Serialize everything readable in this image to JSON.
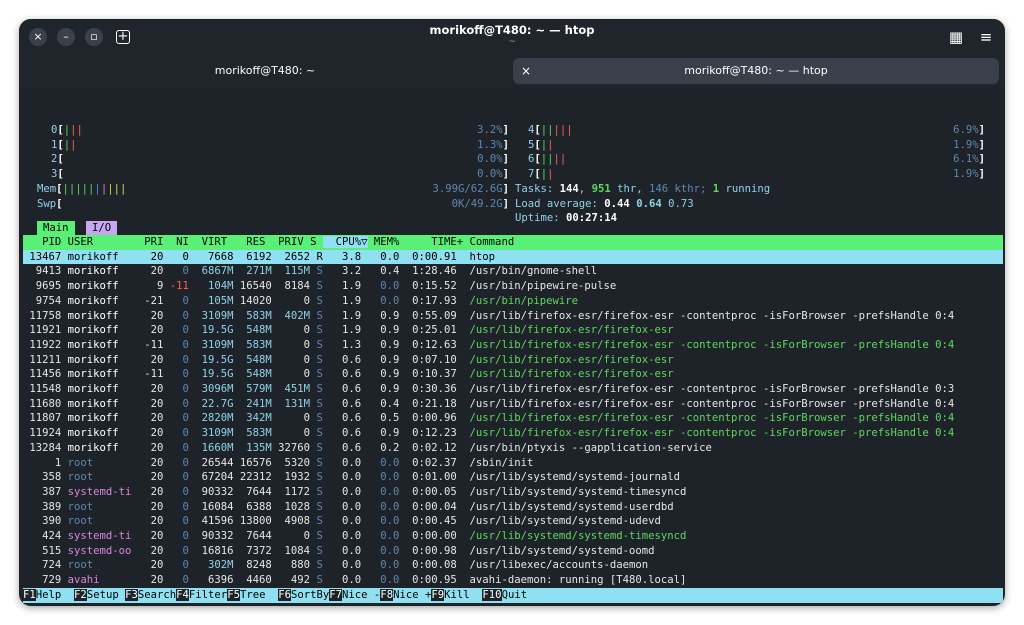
{
  "window": {
    "title": "morikoff@T480: ~ — htop",
    "subtitle": "~",
    "close_icon": "×",
    "minimize_icon": "–",
    "maximize_icon": "▫",
    "new_tab_icon": "+",
    "grid_icon": "▦",
    "menu_icon": "≡"
  },
  "tabs": [
    {
      "label": "morikoff@T480: ~",
      "active": false
    },
    {
      "label": "morikoff@T480: ~ — htop",
      "active": true
    }
  ],
  "meters": {
    "cpus": [
      {
        "id": "0",
        "bars": "|||",
        "value": "3.2%"
      },
      {
        "id": "1",
        "bars": "||",
        "value": "1.3%"
      },
      {
        "id": "2",
        "bars": "",
        "value": "0.0%"
      },
      {
        "id": "3",
        "bars": "",
        "value": "0.0%"
      },
      {
        "id": "4",
        "bars": "|||||",
        "value": "6.9%"
      },
      {
        "id": "5",
        "bars": "||",
        "value": "1.9%"
      },
      {
        "id": "6",
        "bars": "||||",
        "value": "6.1%"
      },
      {
        "id": "7",
        "bars": "||",
        "value": "1.9%"
      }
    ],
    "mem": {
      "label": "Mem",
      "bars": "||||||||||",
      "value": "3.99G/62.6G"
    },
    "swp": {
      "label": "Swp",
      "bars": "",
      "value": "0K/49.2G"
    },
    "tasks": {
      "label": "Tasks:",
      "count": "144",
      "thr": "951",
      "thr_label": "thr,",
      "kthr": "146 kthr;",
      "running": "1",
      "running_label": "running"
    },
    "load": {
      "label": "Load average:",
      "v1": "0.44",
      "v2": "0.64",
      "v3": "0.73"
    },
    "uptime": {
      "label": "Uptime:",
      "value": "00:27:14"
    }
  },
  "screen_tabs": [
    "Main",
    "I/O"
  ],
  "columns": [
    "PID",
    "USER",
    "PRI",
    "NI",
    "VIRT",
    "RES",
    "PRIV",
    "S",
    "CPU%▽",
    "MEM%",
    "TIME+",
    "Command"
  ],
  "processes": [
    {
      "pid": "13467",
      "user": "morikoff",
      "pri": "20",
      "ni": "0",
      "virt": "7668",
      "res": "6192",
      "priv": "2652",
      "s": "R",
      "cpu": "3.8",
      "mem": "0.0",
      "time": "0:00.91",
      "cmd": "htop",
      "sel": true
    },
    {
      "pid": "9413",
      "user": "morikoff",
      "pri": "20",
      "ni": "0",
      "virt": "6867M",
      "res": "271M",
      "priv": "115M",
      "s": "S",
      "cpu": "3.2",
      "mem": "0.4",
      "time": "1:28.46",
      "cmd": "/usr/bin/gnome-shell"
    },
    {
      "pid": "9695",
      "user": "morikoff",
      "pri": "9",
      "ni": "-11",
      "virt": "104M",
      "res": "16540",
      "priv": "8184",
      "s": "S",
      "cpu": "1.9",
      "mem": "0.0",
      "time": "0:15.52",
      "cmd": "/usr/bin/pipewire-pulse"
    },
    {
      "pid": "9754",
      "user": "morikoff",
      "pri": "-21",
      "ni": "0",
      "virt": "105M",
      "res": "14020",
      "priv": "0",
      "s": "S",
      "cpu": "1.9",
      "mem": "0.0",
      "time": "0:17.93",
      "cmd": "/usr/bin/pipewire",
      "thread": true
    },
    {
      "pid": "11758",
      "user": "morikoff",
      "pri": "20",
      "ni": "0",
      "virt": "3109M",
      "res": "583M",
      "priv": "402M",
      "s": "S",
      "cpu": "1.9",
      "mem": "0.9",
      "time": "0:55.09",
      "cmd": "/usr/lib/firefox-esr/firefox-esr -contentproc -isForBrowser -prefsHandle 0:4"
    },
    {
      "pid": "11921",
      "user": "morikoff",
      "pri": "20",
      "ni": "0",
      "virt": "19.5G",
      "res": "548M",
      "priv": "0",
      "s": "S",
      "cpu": "1.9",
      "mem": "0.9",
      "time": "0:25.01",
      "cmd": "/usr/lib/firefox-esr/firefox-esr",
      "thread": true
    },
    {
      "pid": "11922",
      "user": "morikoff",
      "pri": "-11",
      "ni": "0",
      "virt": "3109M",
      "res": "583M",
      "priv": "0",
      "s": "S",
      "cpu": "1.3",
      "mem": "0.9",
      "time": "0:12.63",
      "cmd": "/usr/lib/firefox-esr/firefox-esr -contentproc -isForBrowser -prefsHandle 0:4",
      "thread": true
    },
    {
      "pid": "11211",
      "user": "morikoff",
      "pri": "20",
      "ni": "0",
      "virt": "19.5G",
      "res": "548M",
      "priv": "0",
      "s": "S",
      "cpu": "0.6",
      "mem": "0.9",
      "time": "0:07.10",
      "cmd": "/usr/lib/firefox-esr/firefox-esr",
      "thread": true
    },
    {
      "pid": "11456",
      "user": "morikoff",
      "pri": "-11",
      "ni": "0",
      "virt": "19.5G",
      "res": "548M",
      "priv": "0",
      "s": "S",
      "cpu": "0.6",
      "mem": "0.9",
      "time": "0:10.37",
      "cmd": "/usr/lib/firefox-esr/firefox-esr",
      "thread": true
    },
    {
      "pid": "11548",
      "user": "morikoff",
      "pri": "20",
      "ni": "0",
      "virt": "3096M",
      "res": "579M",
      "priv": "451M",
      "s": "S",
      "cpu": "0.6",
      "mem": "0.9",
      "time": "0:30.36",
      "cmd": "/usr/lib/firefox-esr/firefox-esr -contentproc -isForBrowser -prefsHandle 0:3"
    },
    {
      "pid": "11680",
      "user": "morikoff",
      "pri": "20",
      "ni": "0",
      "virt": "22.7G",
      "res": "241M",
      "priv": "131M",
      "s": "S",
      "cpu": "0.6",
      "mem": "0.4",
      "time": "0:21.18",
      "cmd": "/usr/lib/firefox-esr/firefox-esr -contentproc -isForBrowser -prefsHandle 0:4"
    },
    {
      "pid": "11807",
      "user": "morikoff",
      "pri": "20",
      "ni": "0",
      "virt": "2820M",
      "res": "342M",
      "priv": "0",
      "s": "S",
      "cpu": "0.6",
      "mem": "0.5",
      "time": "0:00.96",
      "cmd": "/usr/lib/firefox-esr/firefox-esr -contentproc -isForBrowser -prefsHandle 0:4",
      "thread": true
    },
    {
      "pid": "11924",
      "user": "morikoff",
      "pri": "20",
      "ni": "0",
      "virt": "3109M",
      "res": "583M",
      "priv": "0",
      "s": "S",
      "cpu": "0.6",
      "mem": "0.9",
      "time": "0:12.23",
      "cmd": "/usr/lib/firefox-esr/firefox-esr -contentproc -isForBrowser -prefsHandle 0:4",
      "thread": true
    },
    {
      "pid": "13284",
      "user": "morikoff",
      "pri": "20",
      "ni": "0",
      "virt": "1660M",
      "res": "135M",
      "priv": "32760",
      "s": "S",
      "cpu": "0.6",
      "mem": "0.2",
      "time": "0:02.12",
      "cmd": "/usr/bin/ptyxis --gapplication-service"
    },
    {
      "pid": "1",
      "user": "root",
      "pri": "20",
      "ni": "0",
      "virt": "26544",
      "res": "16576",
      "priv": "5320",
      "s": "S",
      "cpu": "0.0",
      "mem": "0.0",
      "time": "0:02.37",
      "cmd": "/sbin/init"
    },
    {
      "pid": "358",
      "user": "root",
      "pri": "20",
      "ni": "0",
      "virt": "67204",
      "res": "22312",
      "priv": "1932",
      "s": "S",
      "cpu": "0.0",
      "mem": "0.0",
      "time": "0:01.00",
      "cmd": "/usr/lib/systemd/systemd-journald"
    },
    {
      "pid": "387",
      "user": "systemd-ti",
      "pri": "20",
      "ni": "0",
      "virt": "90332",
      "res": "7644",
      "priv": "1172",
      "s": "S",
      "cpu": "0.0",
      "mem": "0.0",
      "time": "0:00.05",
      "cmd": "/usr/lib/systemd/systemd-timesyncd"
    },
    {
      "pid": "389",
      "user": "root",
      "pri": "20",
      "ni": "0",
      "virt": "16084",
      "res": "6388",
      "priv": "1028",
      "s": "S",
      "cpu": "0.0",
      "mem": "0.0",
      "time": "0:00.04",
      "cmd": "/usr/lib/systemd/systemd-userdbd"
    },
    {
      "pid": "390",
      "user": "root",
      "pri": "20",
      "ni": "0",
      "virt": "41596",
      "res": "13800",
      "priv": "4908",
      "s": "S",
      "cpu": "0.0",
      "mem": "0.0",
      "time": "0:00.45",
      "cmd": "/usr/lib/systemd/systemd-udevd"
    },
    {
      "pid": "424",
      "user": "systemd-ti",
      "pri": "20",
      "ni": "0",
      "virt": "90332",
      "res": "7644",
      "priv": "0",
      "s": "S",
      "cpu": "0.0",
      "mem": "0.0",
      "time": "0:00.00",
      "cmd": "/usr/lib/systemd/systemd-timesyncd",
      "thread": true
    },
    {
      "pid": "515",
      "user": "systemd-oo",
      "pri": "20",
      "ni": "0",
      "virt": "16816",
      "res": "7372",
      "priv": "1084",
      "s": "S",
      "cpu": "0.0",
      "mem": "0.0",
      "time": "0:00.98",
      "cmd": "/usr/lib/systemd/systemd-oomd"
    },
    {
      "pid": "724",
      "user": "root",
      "pri": "20",
      "ni": "0",
      "virt": "302M",
      "res": "8248",
      "priv": "880",
      "s": "S",
      "cpu": "0.0",
      "mem": "0.0",
      "time": "0:00.08",
      "cmd": "/usr/libexec/accounts-daemon"
    },
    {
      "pid": "729",
      "user": "avahi",
      "pri": "20",
      "ni": "0",
      "virt": "6396",
      "res": "4460",
      "priv": "492",
      "s": "S",
      "cpu": "0.0",
      "mem": "0.0",
      "time": "0:00.95",
      "cmd": "avahi-daemon: running [T480.local]"
    }
  ],
  "function_keys": [
    {
      "key": "F1",
      "label": "Help  "
    },
    {
      "key": "F2",
      "label": "Setup "
    },
    {
      "key": "F3",
      "label": "Search"
    },
    {
      "key": "F4",
      "label": "Filter"
    },
    {
      "key": "F5",
      "label": "Tree  "
    },
    {
      "key": "F6",
      "label": "SortBy"
    },
    {
      "key": "F7",
      "label": "Nice -"
    },
    {
      "key": "F8",
      "label": "Nice +"
    },
    {
      "key": "F9",
      "label": "Kill  "
    },
    {
      "key": "F10",
      "label": "Quit"
    }
  ]
}
